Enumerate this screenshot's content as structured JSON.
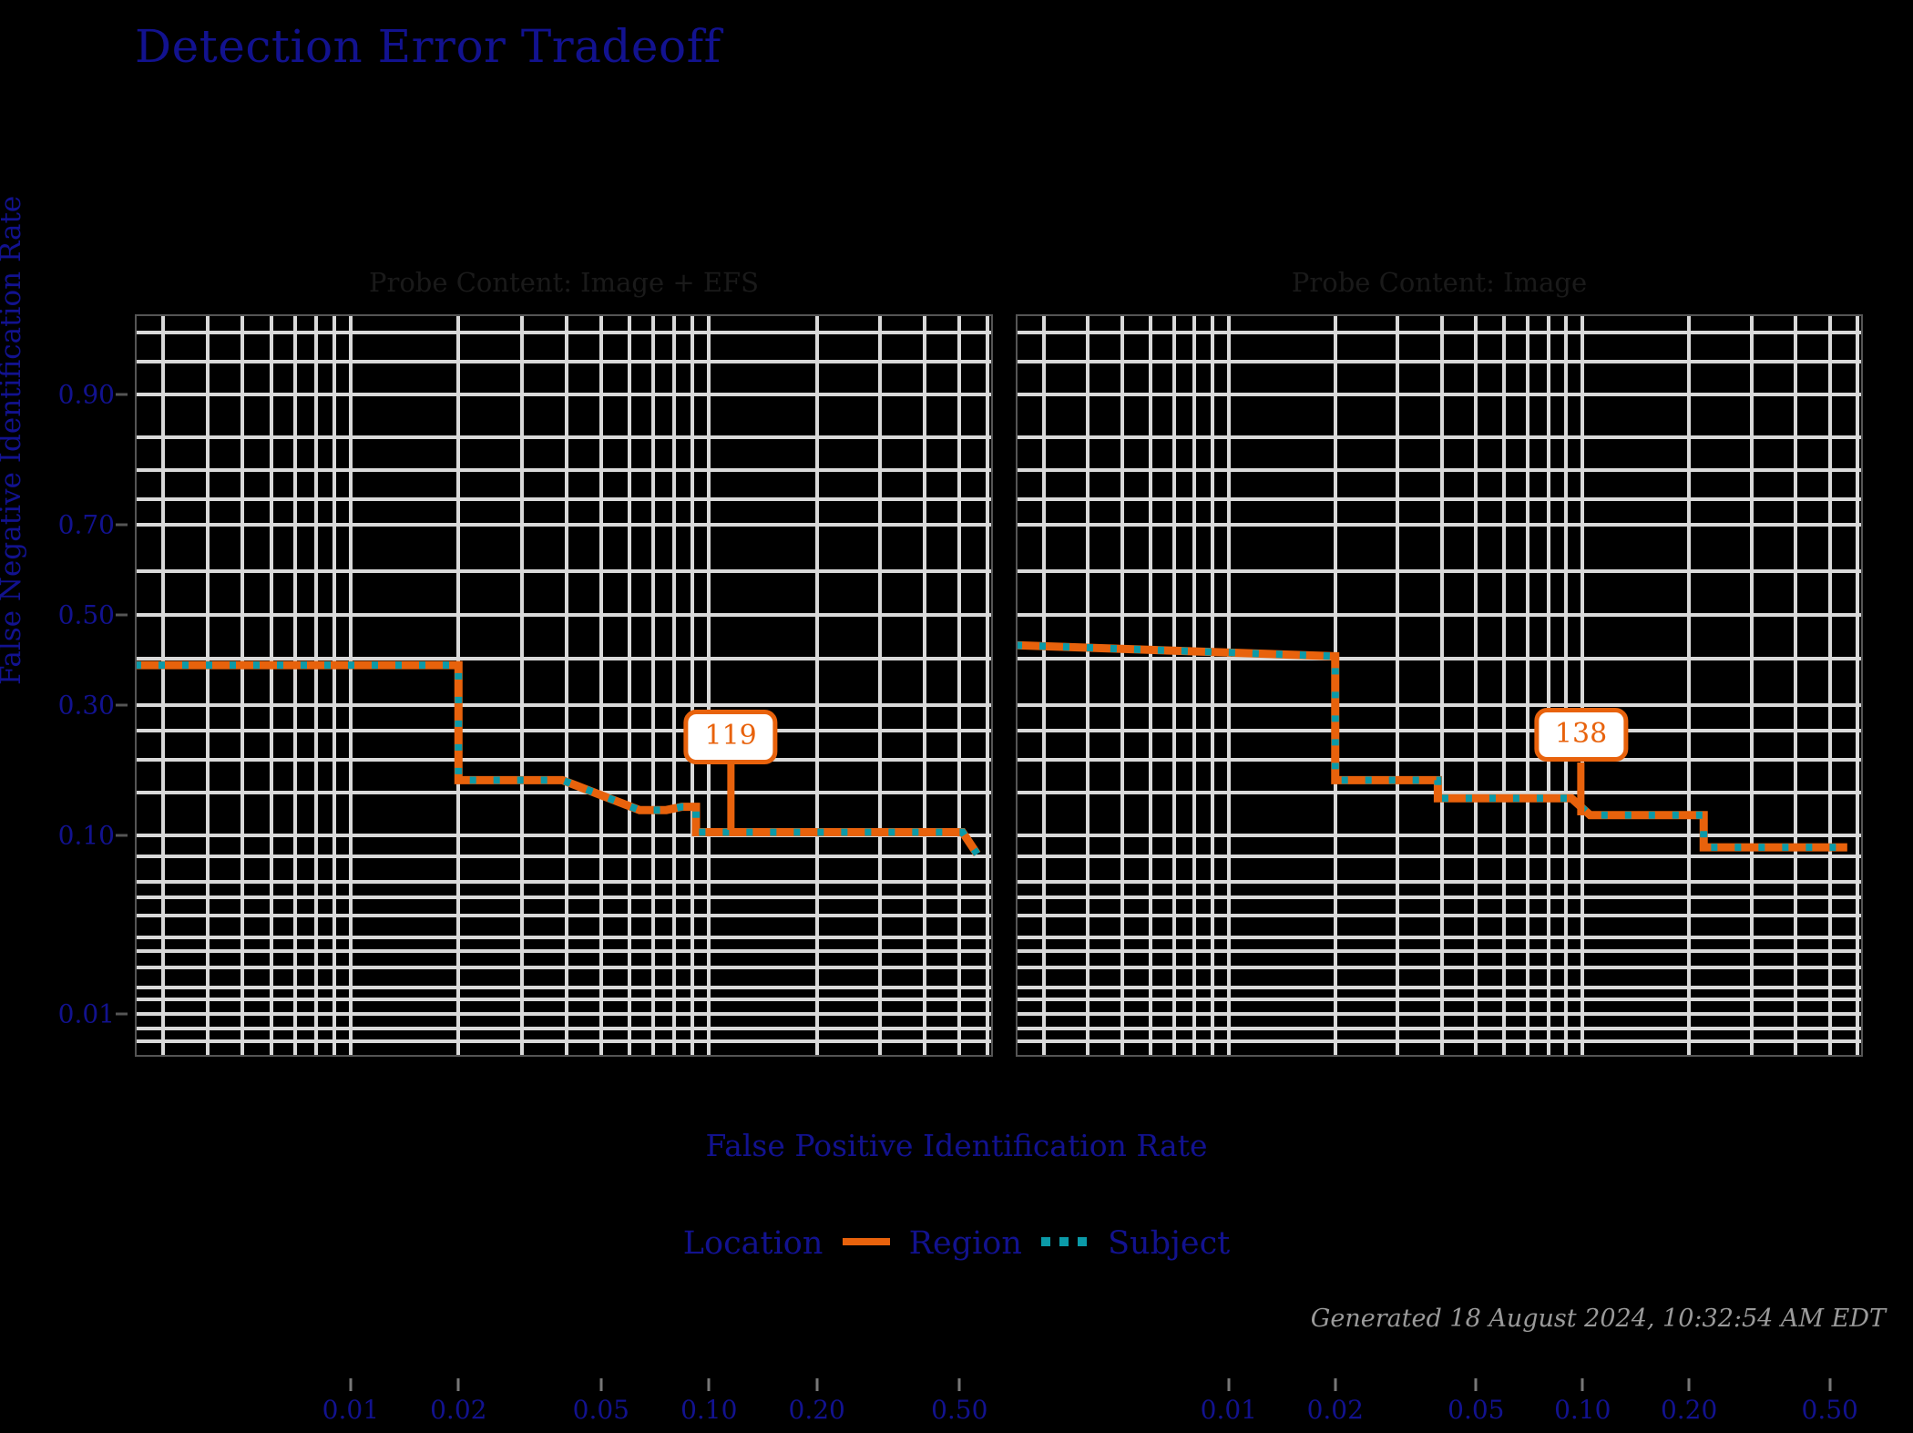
{
  "title": "Detection Error Tradeoff",
  "axes": {
    "x_title": "False Positive Identification Rate",
    "y_title": "False Negative Identification Rate",
    "x_ticks": [
      "0.01",
      "0.02",
      "0.05",
      "0.10",
      "0.20",
      "0.50"
    ],
    "y_ticks": [
      "0.90",
      "0.70",
      "0.50",
      "0.30",
      "0.10",
      "0.01"
    ]
  },
  "panels": [
    {
      "title": "Probe Content: Image + EFS",
      "callout": "119"
    },
    {
      "title": "Probe Content: Image",
      "callout": "138"
    }
  ],
  "legend": {
    "title": "Location",
    "entries": [
      {
        "label": "Region",
        "style": "solid",
        "color": "#e8620c"
      },
      {
        "label": "Subject",
        "style": "dotted",
        "color": "#0b9aa8"
      }
    ]
  },
  "footer": "Generated 18 August 2024, 10:32:54 AM EDT",
  "colors": {
    "background": "#000000",
    "grid": "#d9d9d9",
    "label_blue": "#12128f",
    "panel_title": "#1a1a1a",
    "region_orange": "#e8620c",
    "subject_teal": "#0b9aa8",
    "footer_gray": "#9a9a9a"
  },
  "chart_data": {
    "type": "line",
    "title": "Detection Error Tradeoff",
    "xlabel": "False Positive Identification Rate",
    "ylabel": "False Negative Identification Rate",
    "xscale": "log",
    "yscale": "probit",
    "xlim": [
      0.0025,
      0.62
    ],
    "ylim": [
      0.005,
      0.96
    ],
    "grid": true,
    "legend_position": "bottom",
    "legend_title": "Location",
    "panels": [
      {
        "name": "Probe Content: Image + EFS",
        "annotation": {
          "label": "119",
          "x": 0.115,
          "y": 0.105
        },
        "series": [
          {
            "name": "Region",
            "style": "solid",
            "color": "#e8620c",
            "points": [
              [
                0.0025,
                0.385
              ],
              [
                0.02,
                0.385
              ],
              [
                0.02,
                0.168
              ],
              [
                0.039,
                0.168
              ],
              [
                0.064,
                0.128
              ],
              [
                0.076,
                0.128
              ],
              [
                0.084,
                0.132
              ],
              [
                0.092,
                0.132
              ],
              [
                0.092,
                0.103
              ],
              [
                0.51,
                0.103
              ],
              [
                0.56,
                0.082
              ]
            ]
          },
          {
            "name": "Subject",
            "style": "dotted",
            "color": "#0b9aa8",
            "points": [
              [
                0.0025,
                0.385
              ],
              [
                0.02,
                0.385
              ],
              [
                0.02,
                0.168
              ],
              [
                0.039,
                0.168
              ],
              [
                0.064,
                0.128
              ],
              [
                0.076,
                0.128
              ],
              [
                0.084,
                0.132
              ],
              [
                0.092,
                0.132
              ],
              [
                0.092,
                0.103
              ],
              [
                0.51,
                0.103
              ],
              [
                0.56,
                0.082
              ]
            ]
          }
        ]
      },
      {
        "name": "Probe Content: Image",
        "annotation": {
          "label": "138",
          "x": 0.099,
          "y": 0.122
        },
        "series": [
          {
            "name": "Region",
            "style": "solid",
            "color": "#e8620c",
            "points": [
              [
                0.0025,
                0.43
              ],
              [
                0.02,
                0.405
              ],
              [
                0.02,
                0.168
              ],
              [
                0.039,
                0.168
              ],
              [
                0.039,
                0.143
              ],
              [
                0.093,
                0.143
              ],
              [
                0.105,
                0.122
              ],
              [
                0.22,
                0.122
              ],
              [
                0.22,
                0.088
              ],
              [
                0.56,
                0.088
              ]
            ]
          },
          {
            "name": "Subject",
            "style": "dotted",
            "color": "#0b9aa8",
            "points": [
              [
                0.0025,
                0.43
              ],
              [
                0.02,
                0.405
              ],
              [
                0.02,
                0.168
              ],
              [
                0.039,
                0.168
              ],
              [
                0.039,
                0.143
              ],
              [
                0.093,
                0.143
              ],
              [
                0.105,
                0.122
              ],
              [
                0.22,
                0.122
              ],
              [
                0.22,
                0.088
              ],
              [
                0.56,
                0.088
              ]
            ]
          }
        ]
      }
    ]
  }
}
